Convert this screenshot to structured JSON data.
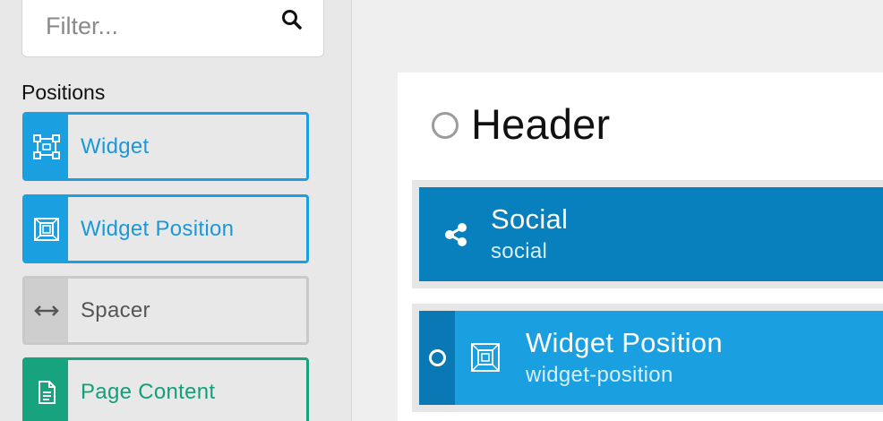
{
  "filter": {
    "placeholder": "Filter...",
    "icon": "search-icon"
  },
  "sidebar": {
    "heading": "Positions",
    "items": [
      {
        "label": "Widget",
        "icon": "widget-icon",
        "color": "#1aa0e0"
      },
      {
        "label": "Widget Position",
        "icon": "widget-position-icon",
        "color": "#1aa0e0"
      },
      {
        "label": "Spacer",
        "icon": "spacer-arrows-icon",
        "color": "#cecece"
      },
      {
        "label": "Page Content",
        "icon": "page-content-icon",
        "color": "#17a37e"
      }
    ]
  },
  "canvas": {
    "section_title": "Header",
    "blocks": [
      {
        "title": "Social",
        "subtitle": "social",
        "icon": "share-icon",
        "color": "#0880bd"
      },
      {
        "title": "Widget Position",
        "subtitle": "widget-position",
        "icon": "widget-position-icon",
        "color": "#1aa0e0"
      }
    ]
  }
}
